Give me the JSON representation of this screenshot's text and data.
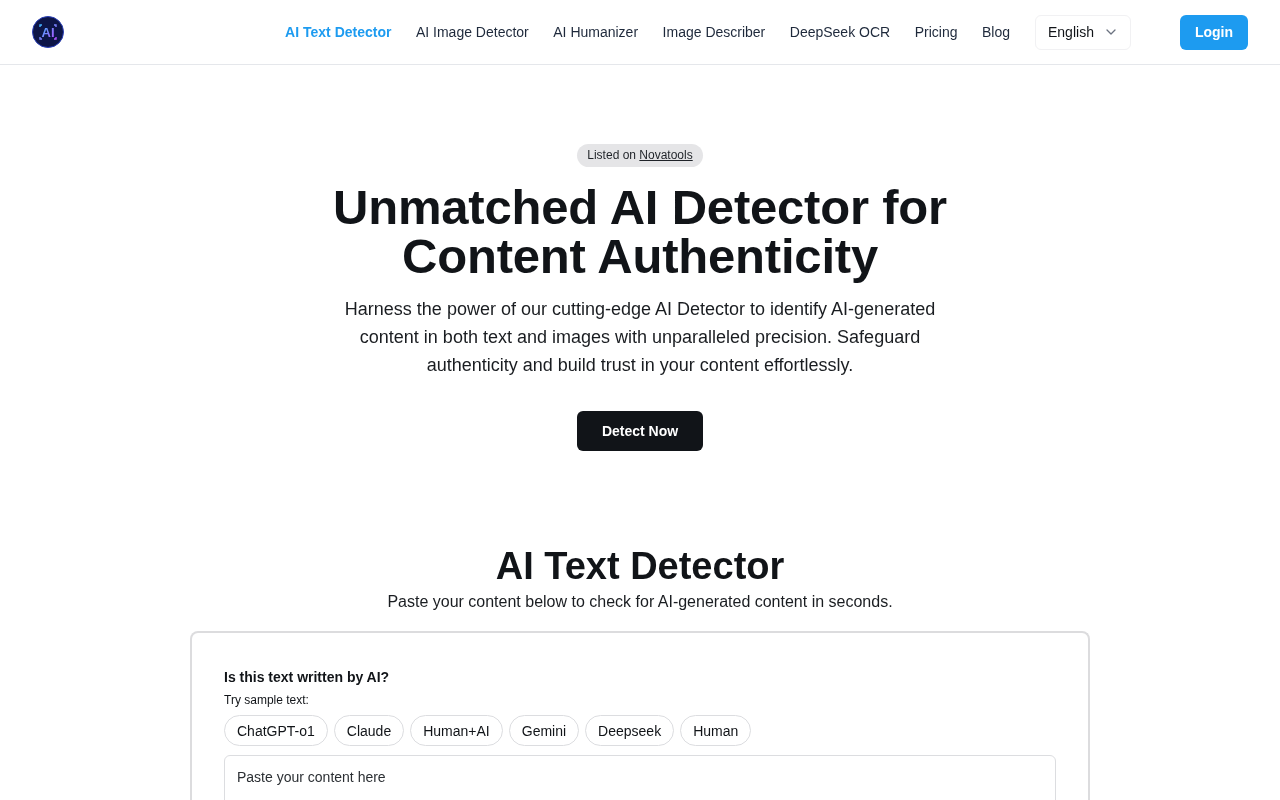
{
  "header": {
    "logo_text": "AI",
    "nav": [
      {
        "label": "AI Text Detector",
        "selected": true
      },
      {
        "label": "AI Image Detector",
        "selected": false
      },
      {
        "label": "AI Humanizer",
        "selected": false
      },
      {
        "label": "Image Describer",
        "selected": false
      },
      {
        "label": "DeepSeek OCR",
        "selected": false
      },
      {
        "label": "Pricing",
        "selected": false
      },
      {
        "label": "Blog",
        "selected": false
      }
    ],
    "language": "English",
    "login": "Login"
  },
  "hero": {
    "badge": {
      "text": "Listed on",
      "link": "Novatools"
    },
    "title": "Unmatched AI Detector for Content Authenticity",
    "description": "Harness the power of our cutting-edge AI Detector to identify AI-generated content in both text and images with unparalleled precision. Safeguard authenticity and build trust in your content effortlessly.",
    "cta": "Detect Now"
  },
  "detector": {
    "title": "AI Text Detector",
    "subtitle": "Paste your content below to check for AI-generated content in seconds.",
    "card": {
      "question": "Is this text written by AI?",
      "samples_label": "Try sample text:",
      "samples": [
        "ChatGPT-o1",
        "Claude",
        "Human+AI",
        "Gemini",
        "Deepseek",
        "Human"
      ],
      "input": {
        "placeholder": "Paste your content here"
      }
    }
  }
}
